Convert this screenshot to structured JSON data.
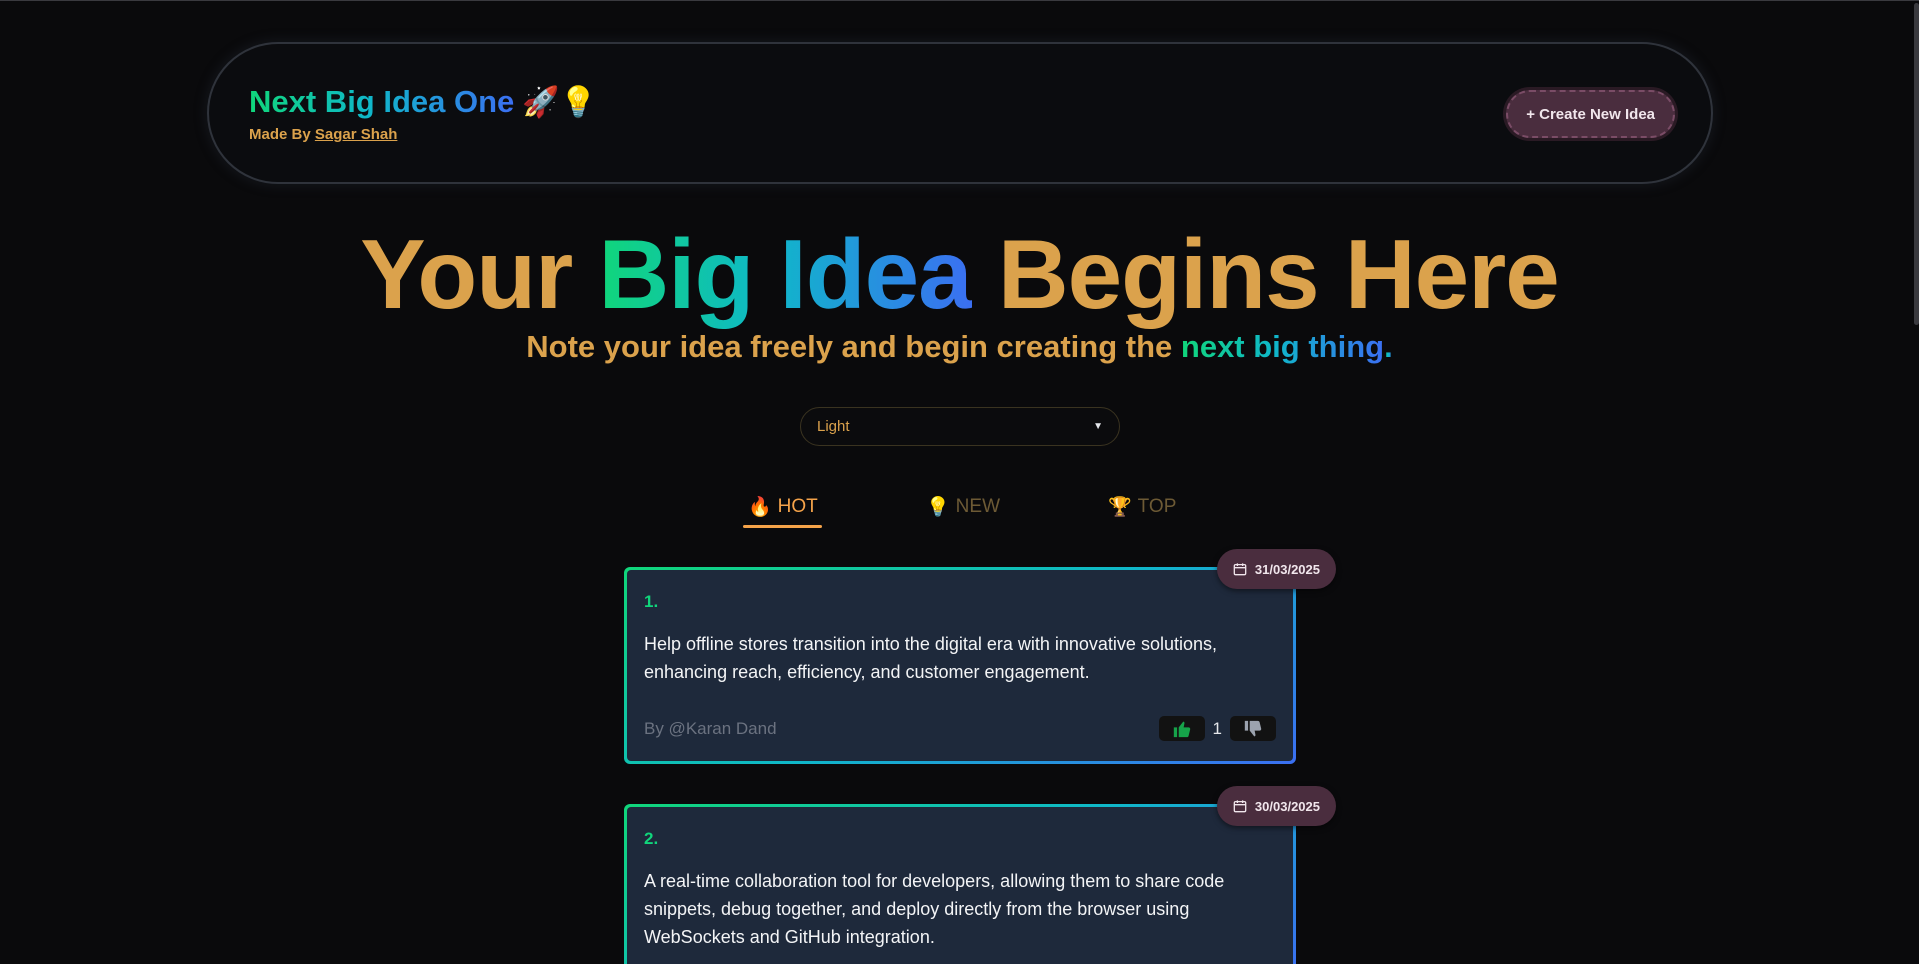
{
  "header": {
    "brand_title": "Next Big Idea One",
    "brand_emoji": "🚀💡",
    "made_by_prefix": "Made By",
    "made_by_name": "Sagar Shah",
    "create_button": "+ Create New Idea"
  },
  "hero": {
    "title_part1": "Your",
    "title_part2": "Big Idea",
    "title_part3": "Begins Here",
    "subtitle_part1": "Note your idea freely and begin creating the",
    "subtitle_part2": "next big thing",
    "subtitle_part3": "."
  },
  "theme_select": {
    "selected": "Light"
  },
  "tabs": [
    {
      "emoji": "🔥",
      "label": "HOT",
      "active": true
    },
    {
      "emoji": "💡",
      "label": "NEW",
      "active": false
    },
    {
      "emoji": "🏆",
      "label": "TOP",
      "active": false
    }
  ],
  "ideas": [
    {
      "number": "1.",
      "date": "31/03/2025",
      "text": "Help offline stores transition into the digital era with innovative solutions, enhancing reach, efficiency, and customer engagement.",
      "author": "By @Karan Dand",
      "votes": "1"
    },
    {
      "number": "2.",
      "date": "30/03/2025",
      "text": "A real-time collaboration tool for developers, allowing them to share code snippets, debug together, and deploy directly from the browser using WebSockets and GitHub integration.",
      "author": "",
      "votes": ""
    }
  ],
  "colors": {
    "background": "#0a0a0c",
    "gold": "#dba24c",
    "gradient_start": "#10d67a",
    "gradient_mid": "#0fb8c9",
    "gradient_end": "#3b6ff2",
    "card_bg": "#1e293b",
    "badge_bg": "#4a2d3e",
    "active_tab": "#f5a34a",
    "upvote": "#16a34a"
  }
}
